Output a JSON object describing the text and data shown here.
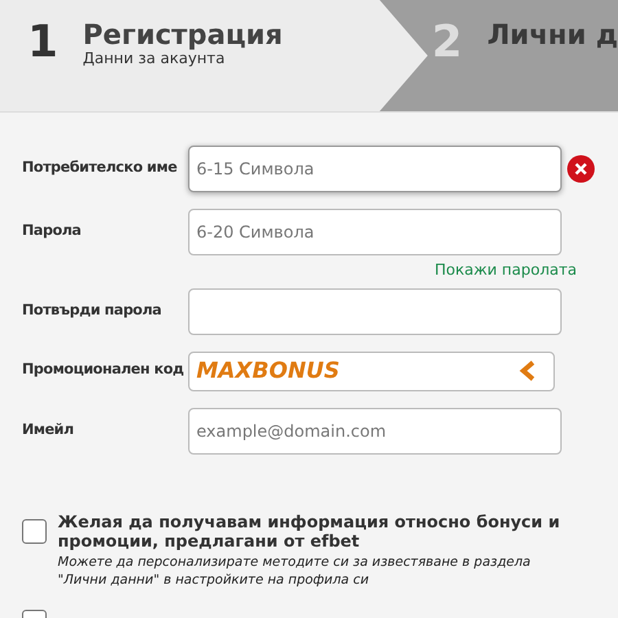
{
  "steps": [
    {
      "number": "1",
      "title": "Регистрация",
      "subtitle": "Данни за акаунта",
      "selected": true
    },
    {
      "number": "2",
      "title": "Лични д",
      "selected": false
    }
  ],
  "fields": [
    {
      "kind": "text",
      "label": "Потребителско име",
      "placeholder": "6-15 Символа",
      "focused": true,
      "error": true
    },
    {
      "kind": "text",
      "label": "Парола",
      "placeholder": "6-20 Символа",
      "link": "Покажи паролата"
    },
    {
      "kind": "text",
      "label": "Потвърди парола"
    },
    {
      "kind": "promo",
      "label": "Промоционален код",
      "value": "MAXBONUS"
    },
    {
      "kind": "text",
      "label": "Имейл",
      "placeholder": "example@domain.com"
    }
  ],
  "consents": [
    {
      "text": "Желая да получавам информация относно бонуси и промоции, предлагани от efbet",
      "note": "Можете да персонализирате методите си за известяване в раздела \"Лични данни\" в настройките на профила си",
      "checked": false
    },
    {
      "checked": false
    }
  ]
}
